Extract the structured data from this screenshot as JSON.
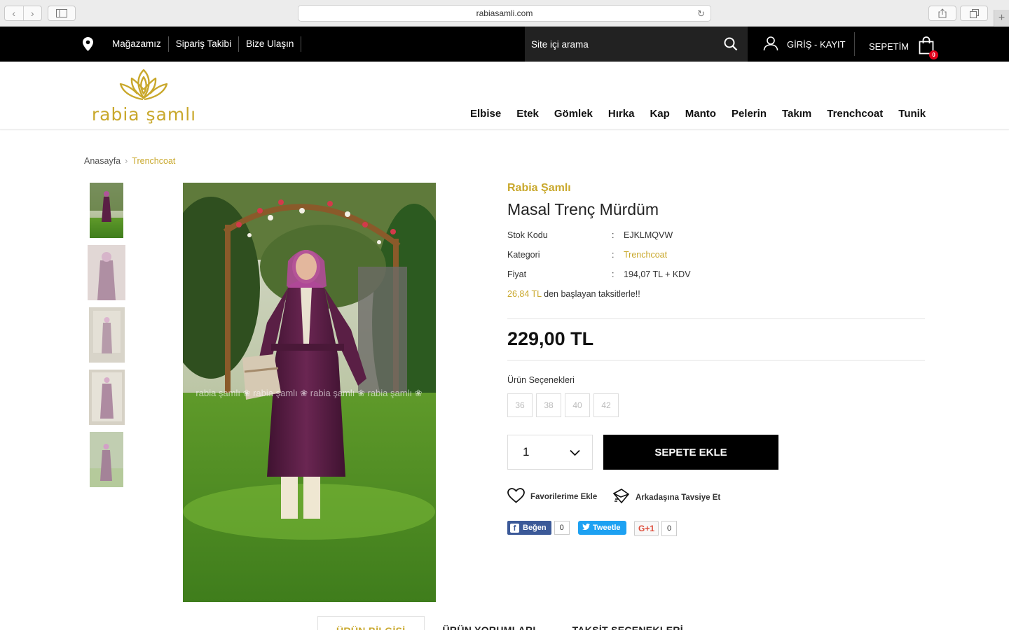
{
  "browser": {
    "url": "rabiasamli.com"
  },
  "topbar": {
    "links": [
      "Mağazamız",
      "Sipariş Takibi",
      "Bize Ulaşın"
    ],
    "search_placeholder": "Site içi arama",
    "login_label": "GİRİŞ - KAYIT",
    "cart_label": "SEPETİM",
    "cart_count": "0"
  },
  "header": {
    "logo_text": "rabia şamlı",
    "nav": [
      "Elbise",
      "Etek",
      "Gömlek",
      "Hırka",
      "Kap",
      "Manto",
      "Pelerin",
      "Takım",
      "Trenchcoat",
      "Tunik"
    ]
  },
  "breadcrumb": {
    "home": "Anasayfa",
    "current": "Trenchcoat"
  },
  "product": {
    "brand": "Rabia Şamlı",
    "title": "Masal Trenç Mürdüm",
    "specs": [
      {
        "label": "Stok Kodu",
        "value": "EJKLMQVW"
      },
      {
        "label": "Kategori",
        "value": "Trenchcoat"
      },
      {
        "label": "Fiyat",
        "value": "194,07 TL + KDV"
      }
    ],
    "installment_amount": "26,84 TL",
    "installment_text": " den başlayan taksitlerle!!",
    "price": "229,00 TL",
    "options_label": "Ürün Seçenekleri",
    "sizes": [
      "36",
      "38",
      "40",
      "42"
    ],
    "quantity": "1",
    "add_to_cart": "SEPETE EKLE",
    "favorite_label": "Favorilerime Ekle",
    "recommend_label": "Arkadaşına Tavsiye Et",
    "photo_watermark": "rabia şamlı ❀ rabia şamlı ❀ rabia şamlı ❀ rabia şamlı ❀"
  },
  "social": {
    "facebook_label": "Beğen",
    "facebook_count": "0",
    "twitter_label": "Tweetle",
    "gplus_label": "G+1",
    "gplus_count": "0"
  },
  "tabs": [
    "ÜRÜN BİLGİSİ",
    "ÜRÜN YORUMLARI",
    "TAKSİT SEÇENEKLERİ"
  ],
  "colors": {
    "accent_gold": "#c9a82c",
    "topbar_bg": "#000000",
    "button_bg": "#000000",
    "badge_red": "#e3001b",
    "coat_purple": "#5a1f45"
  }
}
